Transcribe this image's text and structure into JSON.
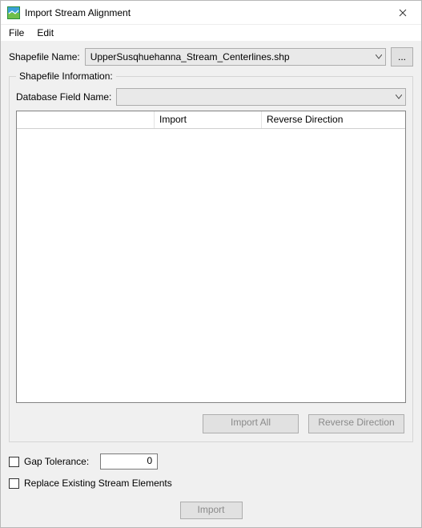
{
  "titlebar": {
    "title": "Import Stream Alignment"
  },
  "menu": {
    "file": "File",
    "edit": "Edit"
  },
  "shapefile": {
    "label": "Shapefile Name:",
    "selected": "UpperSusqhuehanna_Stream_Centerlines.shp",
    "browse": "..."
  },
  "group": {
    "legend": "Shapefile Information:",
    "db_label": "Database Field Name:",
    "db_selected": "",
    "columns": {
      "c0": "",
      "c1": "Import",
      "c2": "Reverse Direction"
    },
    "import_all": "Import All",
    "reverse_dir": "Reverse Direction"
  },
  "options": {
    "gap_label": "Gap Tolerance:",
    "gap_value": "0",
    "replace_label": "Replace Existing Stream Elements"
  },
  "footer": {
    "import": "Import"
  }
}
